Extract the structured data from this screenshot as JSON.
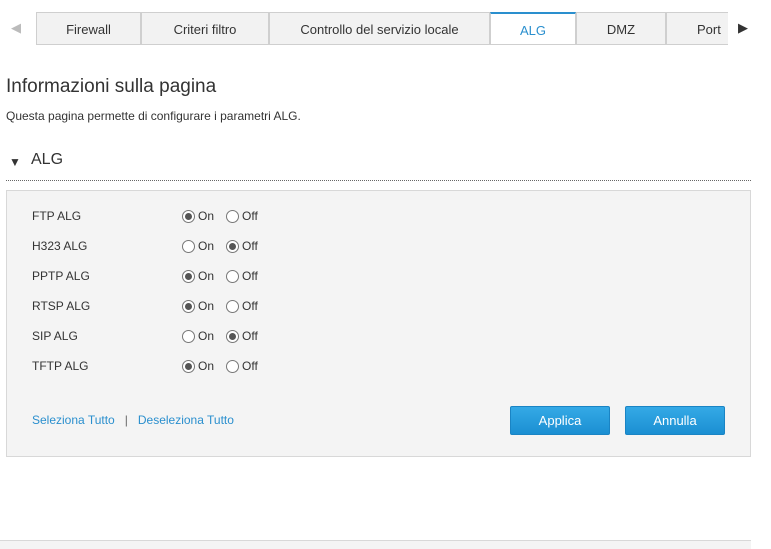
{
  "tabs": {
    "items": [
      {
        "label": "Firewall"
      },
      {
        "label": "Criteri filtro"
      },
      {
        "label": "Controllo del servizio locale"
      },
      {
        "label": "ALG"
      },
      {
        "label": "DMZ"
      },
      {
        "label": "Port"
      }
    ],
    "active": "ALG",
    "left_arrow": "◀",
    "right_arrow": "▶"
  },
  "info": {
    "title": "Informazioni sulla pagina",
    "description": "Questa pagina permette di configurare i parametri ALG."
  },
  "section": {
    "arrow": "▼",
    "title": "ALG"
  },
  "options": {
    "on_label": "On",
    "off_label": "Off"
  },
  "alg_rows": [
    {
      "label": "FTP ALG",
      "value": "On"
    },
    {
      "label": "H323 ALG",
      "value": "Off"
    },
    {
      "label": "PPTP ALG",
      "value": "On"
    },
    {
      "label": "RTSP ALG",
      "value": "On"
    },
    {
      "label": "SIP ALG",
      "value": "Off"
    },
    {
      "label": "TFTP ALG",
      "value": "On"
    }
  ],
  "actions": {
    "select_all": "Seleziona Tutto",
    "separator": "|",
    "deselect_all": "Deseleziona Tutto",
    "apply": "Applica",
    "cancel": "Annulla"
  },
  "colors": {
    "accent": "#2a8fce",
    "button": "#1b8fd2"
  }
}
